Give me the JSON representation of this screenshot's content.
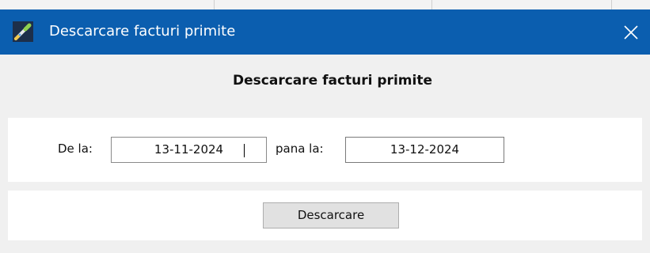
{
  "window": {
    "title": "Descarcare facturi primite",
    "title_bar_color": "#0b5eaf",
    "icon": "pen-brush-icon",
    "close_icon": "close-icon",
    "close_glyph": "✕"
  },
  "heading": "Descarcare facturi primite",
  "date_range": {
    "from_label": "De la:",
    "from_value": "13-11-2024",
    "to_label": "pana la:",
    "to_value": "13-12-2024"
  },
  "actions": {
    "download_label": "Descarcare"
  }
}
